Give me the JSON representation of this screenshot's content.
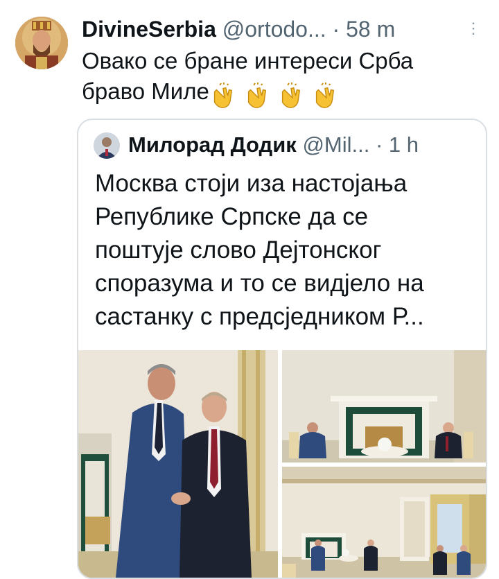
{
  "tweet": {
    "display_name": "DivineSerbia",
    "handle": "@ortodo...",
    "separator": "·",
    "time": "58 m",
    "more": "⋮",
    "text_line1": "Овако се бране интереси Срба",
    "text_line2": "браво Миле",
    "emoji": "clapping-hands-icon"
  },
  "quoted_tweet": {
    "display_name": "Милорад Додик",
    "handle": "@Mil...",
    "separator": "·",
    "time": "1 h",
    "text_lines": [
      "Москва стоји иза настојања",
      "Републике Српске да се",
      "поштује слово Дејтонског",
      "споразума и то се видјело на",
      "састанку с предсједником Р..."
    ]
  },
  "colors": {
    "text": "#0f1419",
    "secondary": "#536471",
    "border": "#d9dee3",
    "emoji": "#f6c233"
  }
}
